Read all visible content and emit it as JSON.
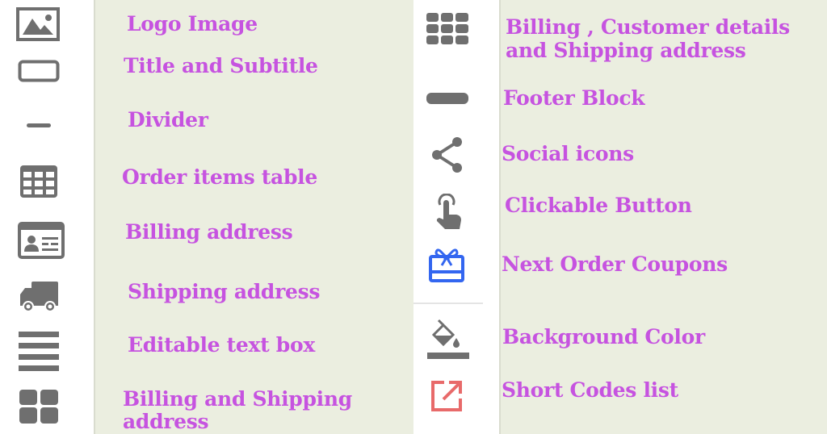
{
  "colors": {
    "label_text": "#c653e0",
    "icon_gray": "#6f6f6f",
    "coupon_icon": "#3366f0",
    "shortcode_icon": "#e86a6a",
    "panel_bg": "#ebeee0",
    "icon_bg": "#ffffff"
  },
  "left_column": [
    {
      "icon": "image-icon",
      "label": "Logo Image"
    },
    {
      "icon": "rectangle-icon",
      "label": "Title and Subtitle"
    },
    {
      "icon": "divider-line-icon",
      "label": "Divider"
    },
    {
      "icon": "table-icon",
      "label": "Order items table"
    },
    {
      "icon": "contact-card-icon",
      "label": "Billing address"
    },
    {
      "icon": "truck-icon",
      "label": "Shipping address"
    },
    {
      "icon": "text-lines-icon",
      "label": "Editable text box"
    },
    {
      "icon": "grid-2x2-icon",
      "label": "Billing and Shipping address"
    }
  ],
  "right_column": [
    {
      "icon": "grid-3x3-icon",
      "label": "Billing , Customer details and Shipping address"
    },
    {
      "icon": "footer-bar-icon",
      "label": "Footer Block"
    },
    {
      "icon": "share-icon",
      "label": "Social icons"
    },
    {
      "icon": "pointer-hand-icon",
      "label": "Clickable Button"
    },
    {
      "icon": "gift-card-icon",
      "label": "Next Order Coupons"
    },
    {
      "icon": "paint-bucket-icon",
      "label": "Background Color"
    },
    {
      "icon": "external-link-icon",
      "label": "Short Codes list"
    }
  ]
}
